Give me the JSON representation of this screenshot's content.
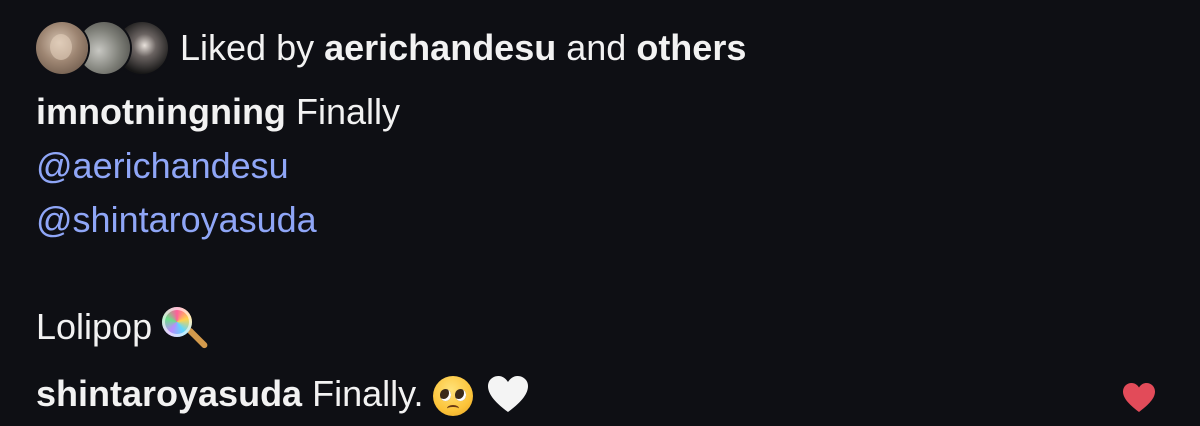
{
  "likes": {
    "prefix": "Liked by",
    "first_liker": "aerichandesu",
    "joiner": "and",
    "others": "others"
  },
  "caption": {
    "author": "imnotningning",
    "first_line": "Finally",
    "mentions": [
      "@aerichandesu",
      "@shintaroyasuda"
    ],
    "last_line": "Lolipop",
    "emoji": "lollipop-icon"
  },
  "comment": {
    "author": "shintaroyasuda",
    "text": "Finally.",
    "emojis": [
      "pleading-face-icon",
      "white-heart-icon"
    ]
  },
  "colors": {
    "background": "#0e0f14",
    "mention": "#8fa6f7",
    "like_heart": "#e24b59"
  }
}
